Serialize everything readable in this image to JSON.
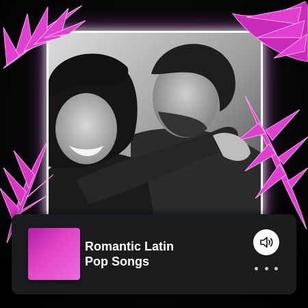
{
  "playlist": {
    "title_line1": "Romantic Latin",
    "title_line2": "Pop Songs"
  },
  "controls": {
    "volume_icon": "speaker-volume-icon",
    "more_icon": "more-options-icon"
  },
  "colors": {
    "card_background": "#1b1c1e",
    "thumbnail_gradient_start": "#b11fa2",
    "thumbnail_gradient_end": "#f06adf",
    "leaf_accent": "#e040d0",
    "frame_glow": "#ffffff"
  }
}
